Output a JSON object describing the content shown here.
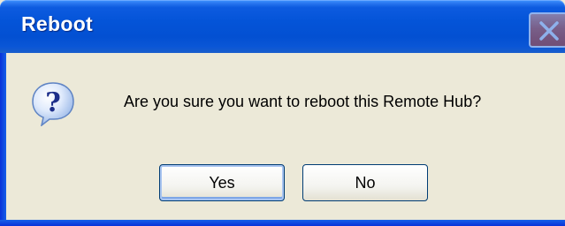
{
  "window": {
    "title": "Reboot"
  },
  "dialog": {
    "icon": "question-icon",
    "message": "Are you sure you want to reboot this Remote Hub?",
    "buttons": {
      "yes_label": "Yes",
      "no_label": "No"
    }
  },
  "colors": {
    "titlebar_blue": "#0454d8",
    "dialog_background": "#ece9d8",
    "close_button": "#d96a4c"
  }
}
